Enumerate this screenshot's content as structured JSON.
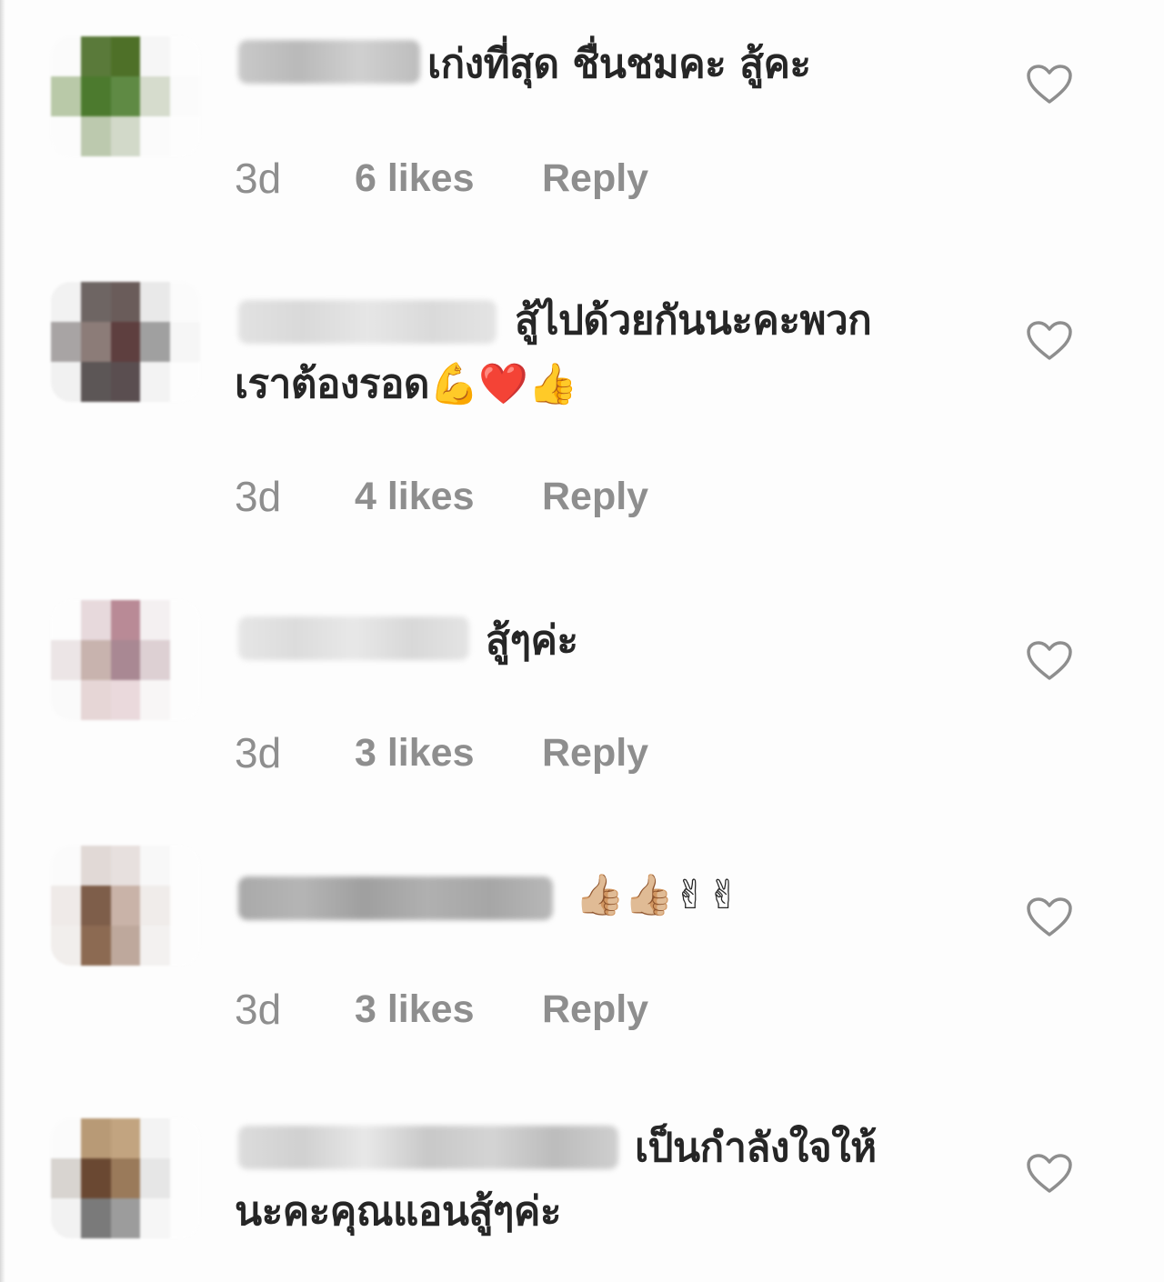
{
  "comments": [
    {
      "text_lines": [
        "เก่งที่สุด ชื่นชมคะ สู้คะ"
      ],
      "time": "3d",
      "likes": "6 likes",
      "reply": "Reply"
    },
    {
      "text_lines": [
        "สู้ไปด้วยกันนะคะพวก",
        "เราต้องรอด"
      ],
      "emoji": "💪❤️👍",
      "time": "3d",
      "likes": "4 likes",
      "reply": "Reply"
    },
    {
      "text_lines": [
        "สู้ๆค่ะ"
      ],
      "time": "3d",
      "likes": "3 likes",
      "reply": "Reply"
    },
    {
      "text_lines": [],
      "emoji": "👍🏼👍🏼✌✌",
      "time": "3d",
      "likes": "3 likes",
      "reply": "Reply"
    },
    {
      "text_lines": [
        "เป็นกำลังใจให้",
        "นะคะคุณแอนสู้ๆค่ะ"
      ]
    }
  ],
  "icons": {
    "like": "heart-outline-icon"
  },
  "colors": {
    "text": "#262626",
    "meta": "#8e8e8e",
    "heart_stroke": "#8e8e8e"
  }
}
